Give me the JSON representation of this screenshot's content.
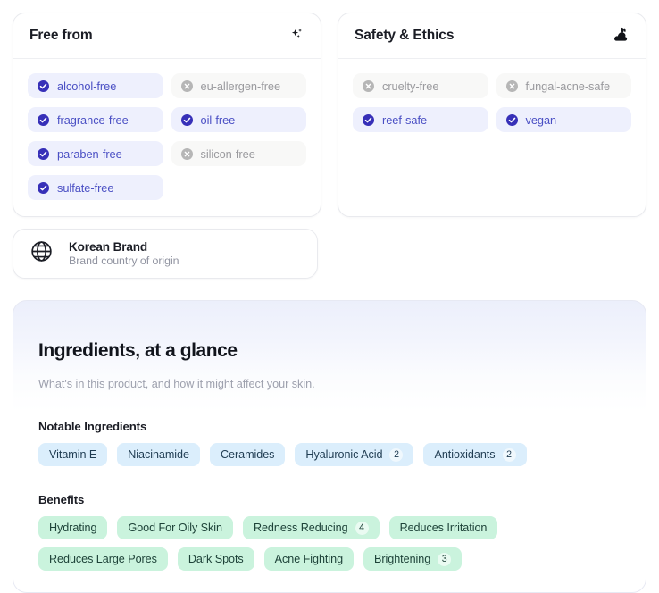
{
  "cards": [
    {
      "title": "Free from",
      "icon": "sparkles-icon",
      "icon_glyph": "✦",
      "items": [
        {
          "label": "alcohol-free",
          "state": "yes"
        },
        {
          "label": "eu-allergen-free",
          "state": "no"
        },
        {
          "label": "fragrance-free",
          "state": "yes"
        },
        {
          "label": "oil-free",
          "state": "yes"
        },
        {
          "label": "paraben-free",
          "state": "yes"
        },
        {
          "label": "silicon-free",
          "state": "no"
        },
        {
          "label": "sulfate-free",
          "state": "yes"
        }
      ]
    },
    {
      "title": "Safety & Ethics",
      "icon": "rabbit-icon",
      "icon_glyph": "🐇",
      "items": [
        {
          "label": "cruelty-free",
          "state": "no"
        },
        {
          "label": "fungal-acne-safe",
          "state": "no"
        },
        {
          "label": "reef-safe",
          "state": "yes"
        },
        {
          "label": "vegan",
          "state": "yes"
        }
      ]
    }
  ],
  "brand": {
    "icon": "globe-icon",
    "name": "Korean Brand",
    "subtitle": "Brand country of origin"
  },
  "ingredients": {
    "title": "Ingredients, at a glance",
    "subtitle": "What's in this product, and how it might affect your skin.",
    "notable_label": "Notable Ingredients",
    "notable": [
      {
        "label": "Vitamin E",
        "count": null
      },
      {
        "label": "Niacinamide",
        "count": null
      },
      {
        "label": "Ceramides",
        "count": null
      },
      {
        "label": "Hyaluronic Acid",
        "count": "2"
      },
      {
        "label": "Antioxidants",
        "count": "2"
      }
    ],
    "benefits_label": "Benefits",
    "benefits": [
      {
        "label": "Hydrating",
        "count": null
      },
      {
        "label": "Good For Oily Skin",
        "count": null
      },
      {
        "label": "Redness Reducing",
        "count": "4"
      },
      {
        "label": "Reduces Irritation",
        "count": null
      },
      {
        "label": "Reduces Large Pores",
        "count": null
      },
      {
        "label": "Dark Spots",
        "count": null
      },
      {
        "label": "Acne Fighting",
        "count": null
      },
      {
        "label": "Brightening",
        "count": "3"
      }
    ]
  },
  "colors": {
    "yes_pill_bg": "#eef0fd",
    "yes_pill_text": "#4a4fc4",
    "yes_icon": "#3730b8",
    "no_pill_bg": "#f8f8f7",
    "no_pill_text": "#9a9a9e",
    "no_icon": "#b6b6b6",
    "ingredient_chip_bg": "#dbeefc",
    "benefit_chip_bg": "#caf3dd",
    "panel_top": "#eceffb"
  }
}
